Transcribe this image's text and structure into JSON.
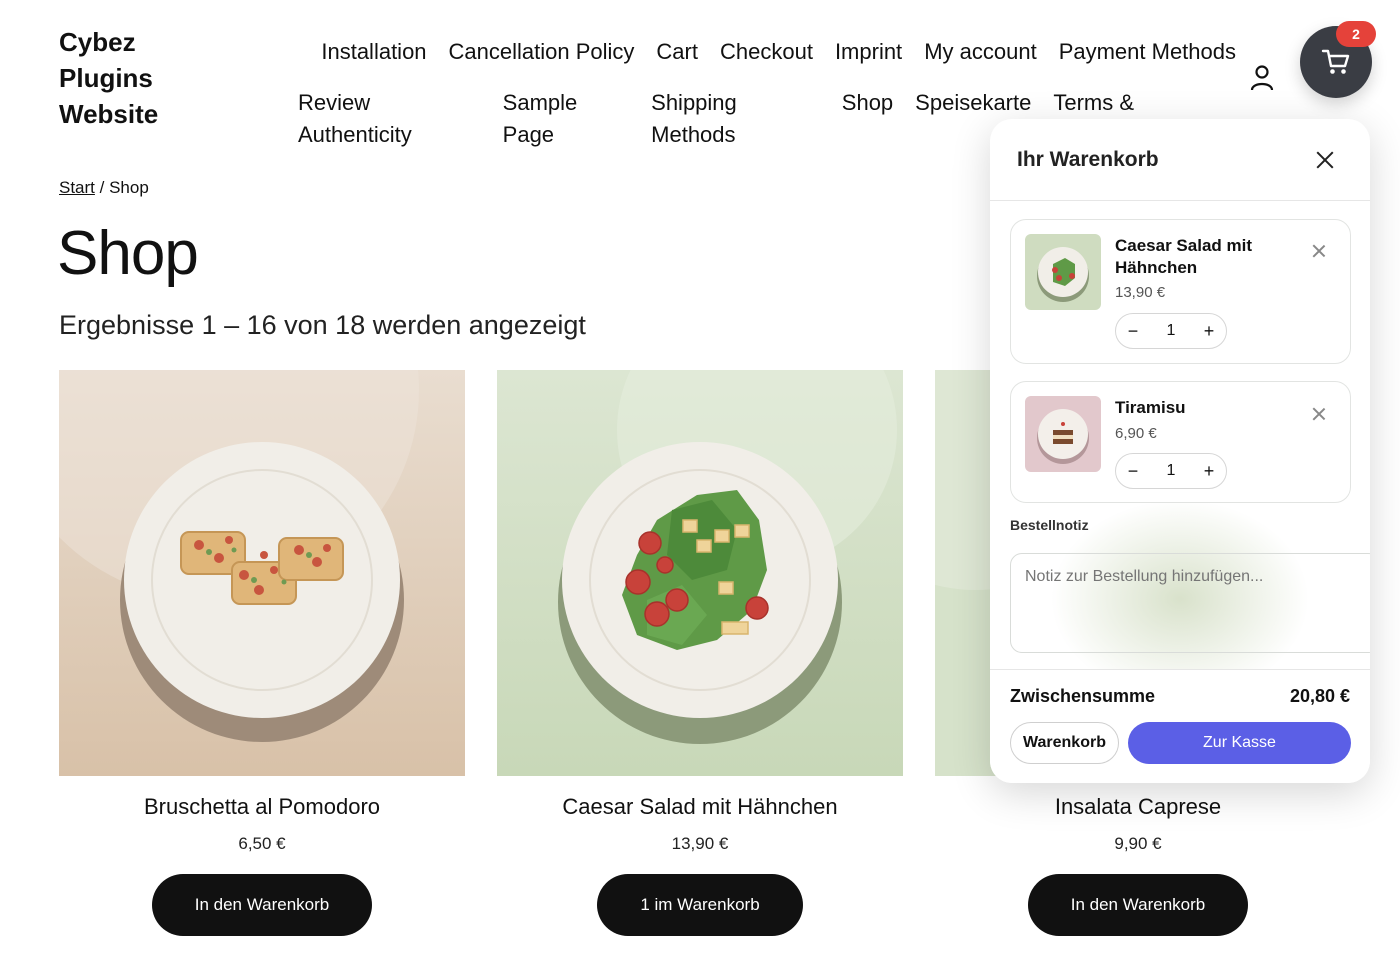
{
  "site": {
    "title_lines": [
      "Cybez",
      "Plugins",
      "Website"
    ]
  },
  "nav": {
    "row1": [
      "Installation",
      "Cancellation Policy",
      "Cart",
      "Checkout",
      "Imprint",
      "My account",
      "Payment Methods"
    ],
    "row2": [
      "Review Authenticity",
      "Sample Page",
      "Shipping Methods",
      "Shop",
      "Speisekarte",
      "Terms & Conditions"
    ]
  },
  "header_icons": {
    "account": "user-icon",
    "cart": "cart-icon",
    "cart_count": "2"
  },
  "breadcrumb": {
    "home": "Start",
    "separator": " / ",
    "current": "Shop"
  },
  "page": {
    "title": "Shop",
    "result_count": "Ergebnisse 1 – 16 von 18 werden angezeigt"
  },
  "products": [
    {
      "name": "Bruschetta al Pomodoro",
      "price": "6,50 €",
      "button": "In den Warenkorb",
      "bg": "#e4d3c1"
    },
    {
      "name": "Caesar Salad mit Hähnchen",
      "price": "13,90 €",
      "button": "1 im Warenkorb",
      "bg": "#d3e0c5"
    },
    {
      "name": "Insalata Caprese",
      "price": "9,90 €",
      "button": "In den Warenkorb",
      "bg": "#d7e3cb"
    }
  ],
  "cart_drawer": {
    "title": "Ihr Warenkorb",
    "items": [
      {
        "name": "Caesar Salad mit Hähnchen",
        "price": "13,90 €",
        "qty": "1",
        "minus": "−",
        "plus": "+"
      },
      {
        "name": "Tiramisu",
        "price": "6,90 €",
        "qty": "1",
        "minus": "−",
        "plus": "+"
      }
    ],
    "note_label": "Bestellnotiz",
    "note_placeholder": "Notiz zur Bestellung hinzufügen...",
    "subtotal_label": "Zwischensumme",
    "subtotal_value": "20,80 €",
    "cart_button": "Warenkorb",
    "checkout_button": "Zur Kasse"
  },
  "colors": {
    "accent": "#5b5fe6",
    "badge": "#e5423a",
    "fab": "#3a3d44",
    "button_dark": "#111111"
  }
}
